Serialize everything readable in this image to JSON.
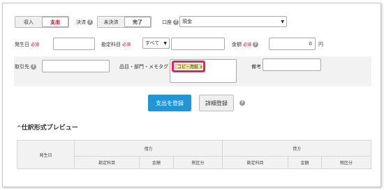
{
  "type_toggle": {
    "income": "収入",
    "expense": "支出"
  },
  "settlement": {
    "label": "決済",
    "unsettled": "未決済",
    "completed": "完了"
  },
  "account": {
    "label": "口座",
    "value": "現金"
  },
  "row1": {
    "date_label": "発生日",
    "required": "必須",
    "subject_label": "勘定科目",
    "subject_value": "すべて",
    "amount_label": "金額",
    "amount_value": "0",
    "currency": "円"
  },
  "row2": {
    "partner_label": "取引先",
    "item_label": "品目・部門・メモタグ",
    "tag_value": "コピー用紙 ×",
    "note_label": "備考"
  },
  "buttons": {
    "register": "支出を登録",
    "detail": "詳細登録"
  },
  "help_symbol": "?",
  "preview": {
    "title": "仕訳形式プレビュー",
    "collapse_icon": "^",
    "date_header": "発生日",
    "debit": "借方",
    "credit": "貸方",
    "sub_headers": [
      "勘定科目",
      "金額",
      "税区分",
      "勘定科目",
      "金額",
      "税区分"
    ]
  },
  "colors": {
    "primary": "#2196d6",
    "highlight": "#e0245e",
    "tag_bg": "#f5e6a5"
  }
}
